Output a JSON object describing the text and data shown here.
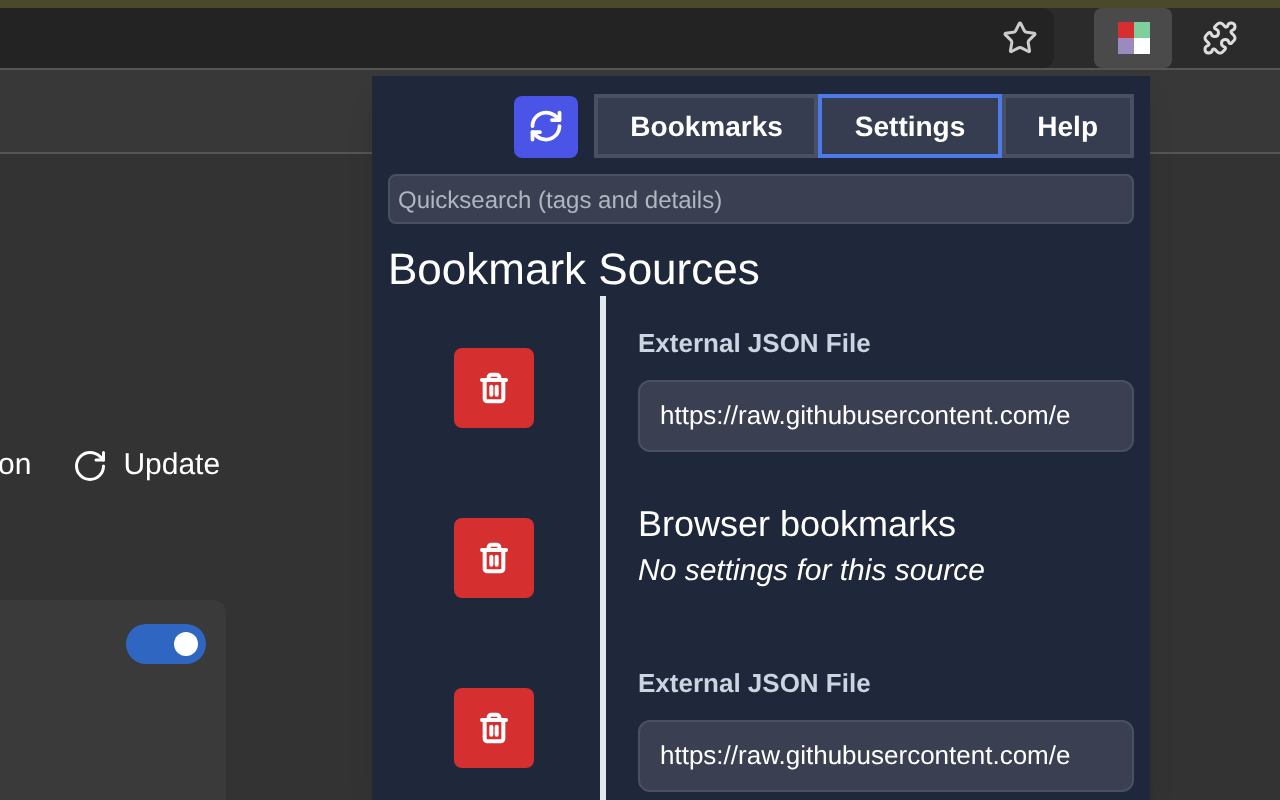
{
  "page": {
    "cut_text": "on",
    "update_button": "Update",
    "toggle": {
      "on": true
    }
  },
  "popup": {
    "tabs": [
      {
        "label": "Bookmarks",
        "selected": false
      },
      {
        "label": "Settings",
        "selected": true
      },
      {
        "label": "Help",
        "selected": false
      }
    ],
    "search": {
      "placeholder": "Quicksearch (tags and details)"
    },
    "title": "Bookmark Sources",
    "sources": [
      {
        "kind": "json",
        "label": "External JSON File",
        "value": "https://raw.githubusercontent.com/e"
      },
      {
        "kind": "browser",
        "title": "Browser bookmarks",
        "note": "No settings for this source"
      },
      {
        "kind": "json",
        "label": "External JSON File",
        "value": "https://raw.githubusercontent.com/e"
      }
    ]
  }
}
